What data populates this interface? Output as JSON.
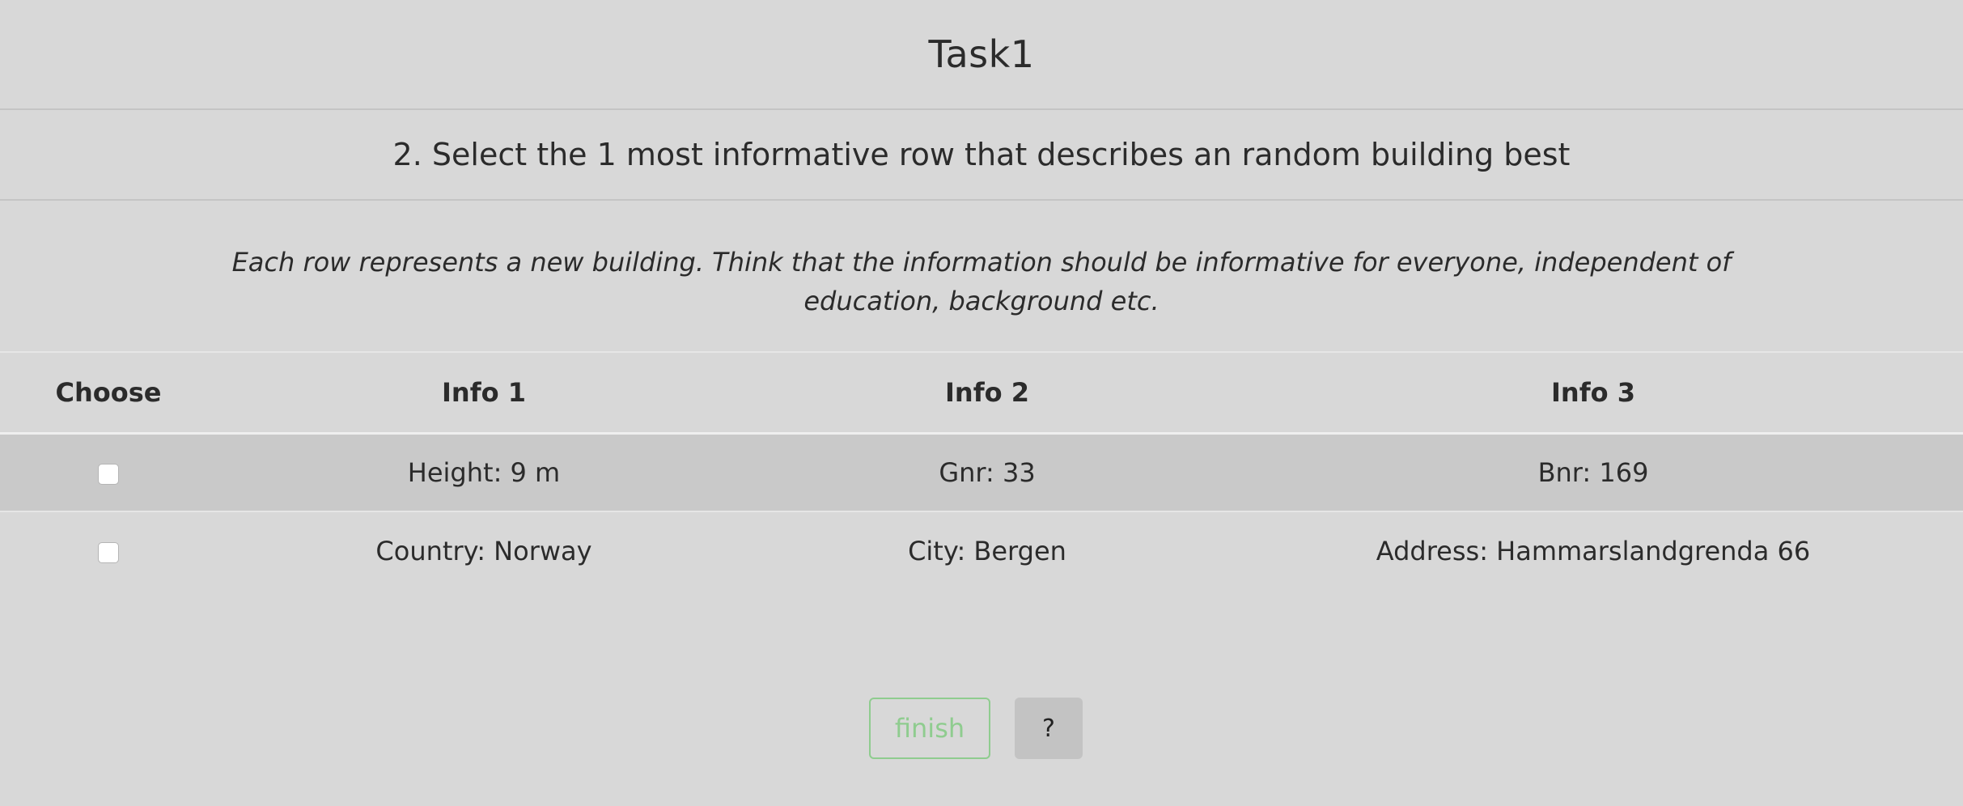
{
  "page": {
    "title": "Task1",
    "question": "2. Select the 1 most informative row that describes an random building best",
    "instructions": "Each row represents a new building. Think that the information should be informative for everyone, independent of education, background etc."
  },
  "table": {
    "headers": [
      "Choose",
      "Info 1",
      "Info 2",
      "Info 3"
    ],
    "rows": [
      {
        "checked": false,
        "info1": "Height: 9 m",
        "info2": "Gnr: 33",
        "info3": "Bnr: 169"
      },
      {
        "checked": false,
        "info1": "Country: Norway",
        "info2": "City: Bergen",
        "info3": "Address: Hammarslandgrenda 66"
      }
    ]
  },
  "buttons": {
    "finish_label": "finish",
    "help_label": "?"
  },
  "colors": {
    "background": "#d8d8d8",
    "row_highlight": "#c9c9c9",
    "finish_accent": "#8fcc8f",
    "help_button": "#c3c3c3"
  }
}
